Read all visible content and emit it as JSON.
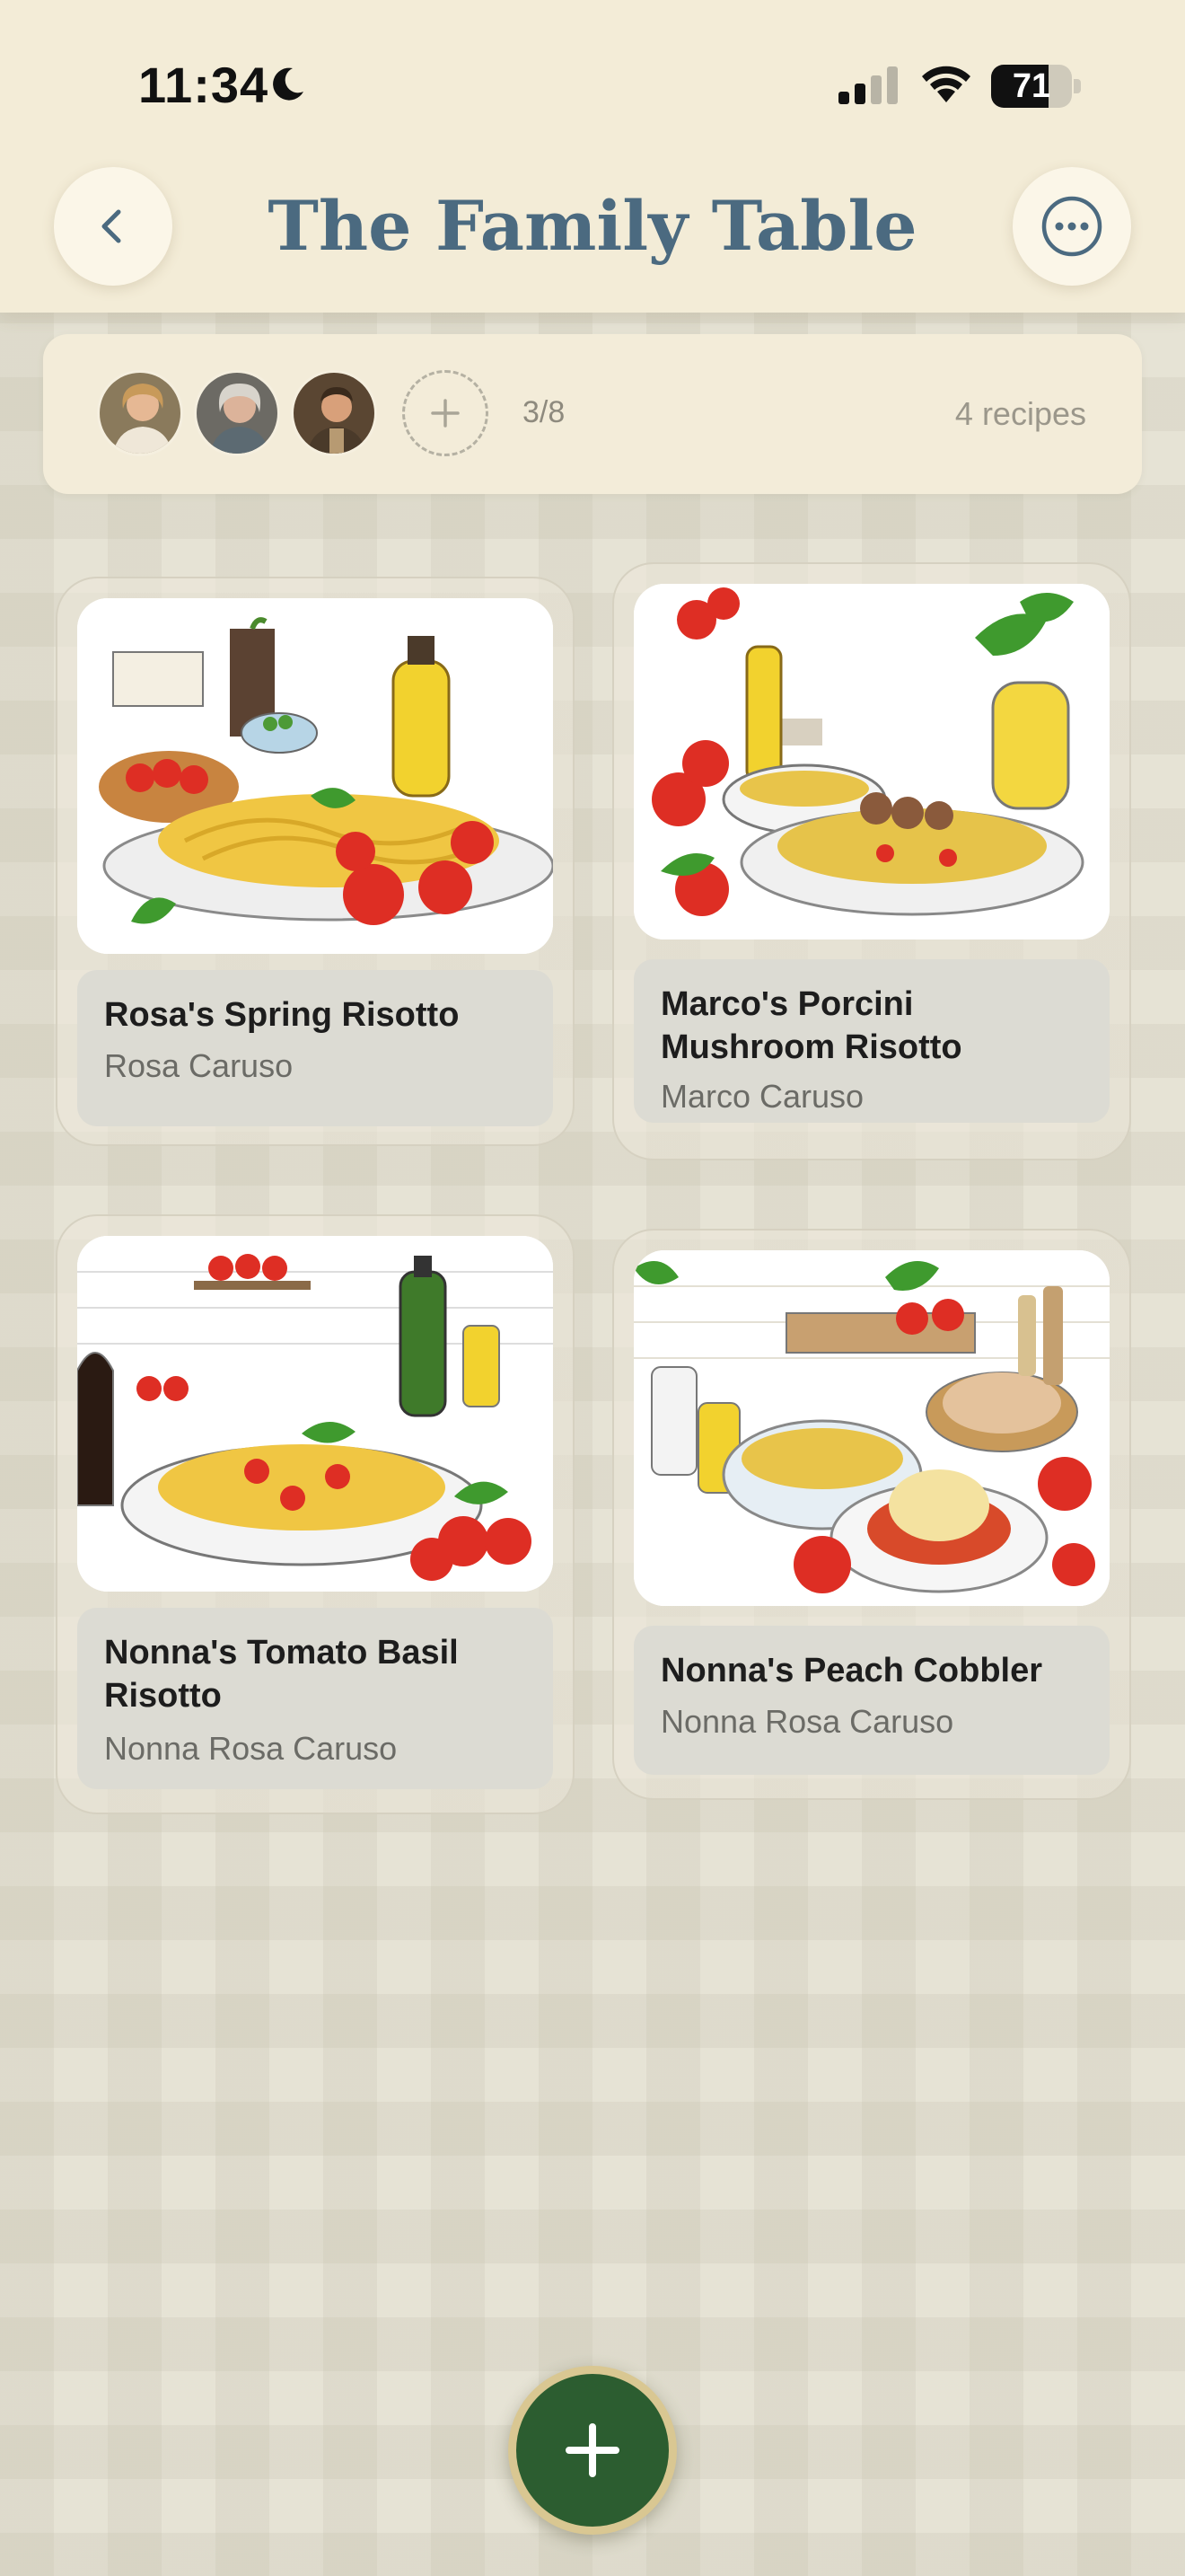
{
  "status_bar": {
    "time": "11:34",
    "battery_level": 71,
    "battery_text": "71"
  },
  "header": {
    "title": "The Family Table",
    "back_icon": "chevron-left-icon",
    "more_icon": "ellipsis-circle-icon"
  },
  "members": {
    "count_text": "3/8",
    "recipes_text": "4 recipes",
    "add_icon": "plus-icon"
  },
  "recipes": [
    {
      "title": "Rosa's Spring Risotto",
      "author": "Rosa Caruso"
    },
    {
      "title": "Marco's Porcini Mushroom Risotto",
      "author": "Marco Caruso"
    },
    {
      "title": "Nonna's Tomato Basil Risotto",
      "author": "Nonna Rosa Caruso"
    },
    {
      "title": "Nonna's Peach Cobbler",
      "author": "Nonna Rosa Caruso"
    }
  ],
  "fab": {
    "icon": "plus-icon"
  },
  "colors": {
    "title": "#4b6a80",
    "fab": "#2c5d30",
    "fab_ring": "#d9c792",
    "header_bg": "#f3ecd7"
  }
}
